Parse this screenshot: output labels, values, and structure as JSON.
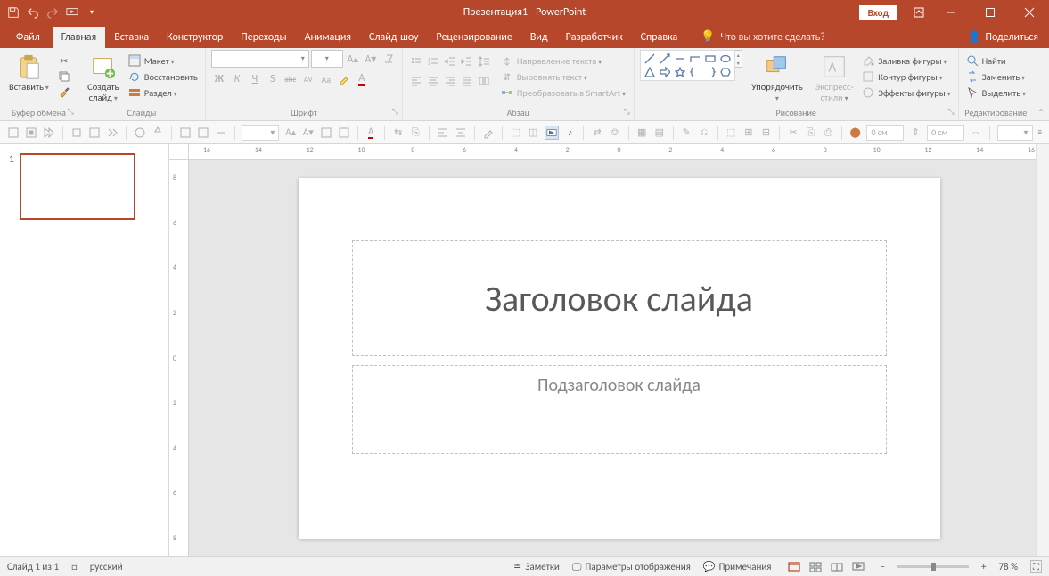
{
  "title": "Презентация1  -  PowerPoint",
  "signin": "Вход",
  "tabs": {
    "file": "Файл",
    "home": "Главная",
    "insert": "Вставка",
    "design": "Конструктор",
    "transitions": "Переходы",
    "animations": "Анимация",
    "slideshow": "Слайд-шоу",
    "review": "Рецензирование",
    "view": "Вид",
    "developer": "Разработчик",
    "help": "Справка",
    "tell_me": "Что вы хотите сделать?",
    "share": "Поделиться"
  },
  "ribbon": {
    "clipboard": {
      "paste": "Вставить",
      "label": "Буфер обмена"
    },
    "slides": {
      "new_slide": "Создать\nслайд",
      "layout": "Макет",
      "reset": "Восстановить",
      "section": "Раздел",
      "label": "Слайды"
    },
    "font": {
      "label": "Шрифт",
      "bold": "Ж",
      "italic": "К",
      "underline": "Ч",
      "shadow": "S",
      "strike": "abc",
      "spacing": "AV",
      "case": "Aa"
    },
    "paragraph": {
      "label": "Абзац",
      "text_direction": "Направление текста",
      "align_text": "Выровнять текст",
      "smartart": "Преобразовать в SmartArt"
    },
    "drawing": {
      "arrange": "Упорядочить",
      "quick_styles": "Экспресс-\nстили",
      "fill": "Заливка фигуры",
      "outline": "Контур фигуры",
      "effects": "Эффекты фигуры",
      "label": "Рисование"
    },
    "editing": {
      "find": "Найти",
      "replace": "Заменить",
      "select": "Выделить",
      "label": "Редактирование"
    }
  },
  "sub_toolbar": {
    "box1": "0 см",
    "box2": "0 см"
  },
  "slide": {
    "title_placeholder": "Заголовок слайда",
    "subtitle_placeholder": "Подзаголовок слайда"
  },
  "thumbnails": {
    "current": "1"
  },
  "status": {
    "slide_count": "Слайд 1 из 1",
    "language": "русский",
    "notes": "Заметки",
    "display_settings": "Параметры отображения",
    "comments": "Примечания",
    "zoom": "78 %"
  },
  "hruler_ticks": [
    "16",
    "14",
    "12",
    "10",
    "8",
    "6",
    "4",
    "2",
    "0",
    "2",
    "4",
    "6",
    "8",
    "10",
    "12",
    "14",
    "16"
  ],
  "vruler_ticks": [
    "8",
    "6",
    "4",
    "2",
    "0",
    "2",
    "4",
    "6",
    "8"
  ]
}
